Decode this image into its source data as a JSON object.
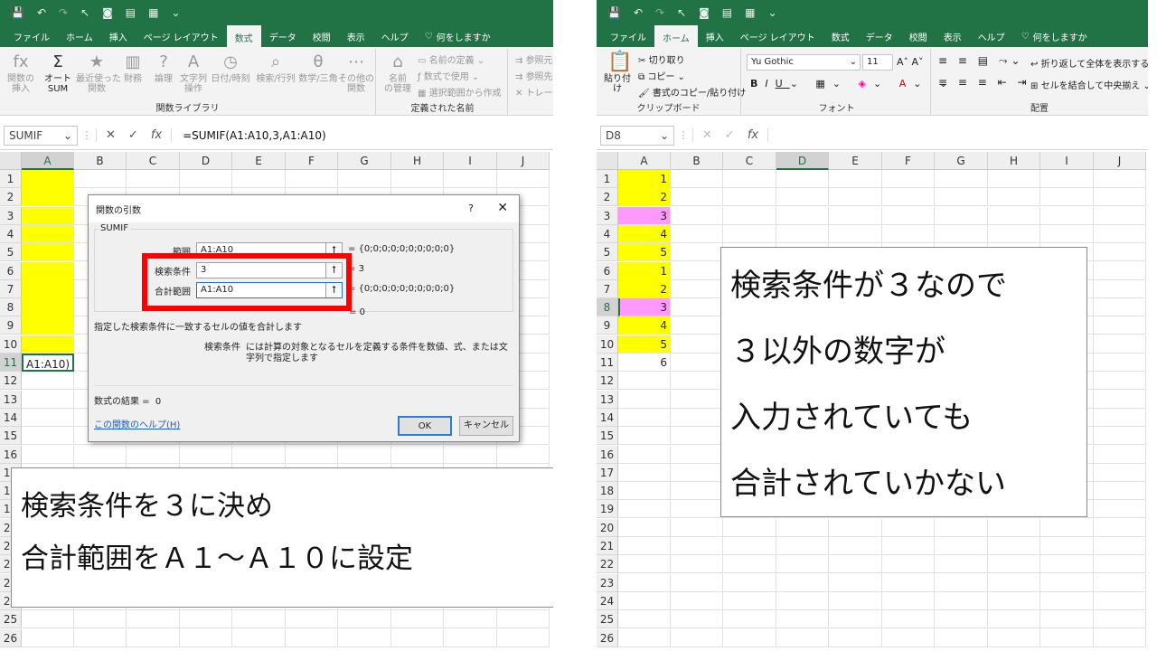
{
  "left": {
    "tabs": [
      "ファイル",
      "ホーム",
      "挿入",
      "ページ レイアウト",
      "数式",
      "データ",
      "校閲",
      "表示",
      "ヘルプ",
      "何をしますか"
    ],
    "active_tab": "数式",
    "ribbon": {
      "buttons": [
        "関数の\n挿入",
        "オート\nSUM",
        "最近使った\n関数",
        "財務",
        "論理",
        "文字列\n操作",
        "日付/時刻",
        "検索/行列",
        "数学/三角",
        "その他の\n関数"
      ],
      "group1": "関数ライブラリ",
      "named": [
        "名前の定義",
        "数式で使用",
        "選択範囲から作成"
      ],
      "name_mgr": "名前\nの管理",
      "group2": "定義された名前",
      "audit": [
        "参照元",
        "参照先",
        "トレース"
      ]
    },
    "namebox": "SUMIF",
    "formula": "=SUMIF(A1:A10,3,A1:A10)",
    "columns": [
      "A",
      "B",
      "C",
      "D",
      "E",
      "F",
      "G",
      "H",
      "I",
      "J"
    ],
    "rows": [
      "1",
      "2",
      "3",
      "4",
      "5",
      "6",
      "7",
      "8",
      "9",
      "10",
      "11",
      "12",
      "13",
      "14",
      "15",
      "16",
      "17",
      "18",
      "19",
      "20",
      "21",
      "22",
      "23",
      "24",
      "25",
      "26"
    ],
    "a11": "A1:A10)",
    "dialog": {
      "title": "関数の引数",
      "help_q": "?",
      "close": "✕",
      "func": "SUMIF",
      "args": [
        {
          "label": "範囲",
          "value": "A1:A10",
          "result": "{0;0;0;0;0;0;0;0;0;0}"
        },
        {
          "label": "検索条件",
          "value": "3",
          "result": "3"
        },
        {
          "label": "合計範囲",
          "value": "A1:A10",
          "result": "{0;0;0;0;0;0;0;0;0;0}"
        }
      ],
      "total": "0",
      "desc": "指定した検索条件に一致するセルの値を合計します",
      "arg_name": "検索条件",
      "arg_desc": "には計算の対象となるセルを定義する条件を数値、式、または文字列で指定します",
      "result_label": "数式の結果 =",
      "result_value": "0",
      "help_link": "この関数のヘルプ(H)",
      "ok": "OK",
      "cancel": "キャンセル"
    },
    "callout": [
      "検索条件を３に決め",
      "合計範囲をＡ１～Ａ１０に設定"
    ]
  },
  "right": {
    "tabs": [
      "ファイル",
      "ホーム",
      "挿入",
      "ページ レイアウト",
      "数式",
      "データ",
      "校閲",
      "表示",
      "ヘルプ",
      "何をしますか"
    ],
    "active_tab": "ホーム",
    "ribbon": {
      "paste": "貼り付け",
      "cut": "切り取り",
      "copy": "コピー",
      "format_painter": "書式のコピー/貼り付け",
      "clipboard": "クリップボード",
      "font_name": "Yu Gothic",
      "font_size": "11",
      "font": "フォント",
      "wrap": "折り返して全体を表示する",
      "merge": "セルを結合して中央揃え",
      "align": "配置"
    },
    "namebox": "D8",
    "formula": "",
    "columns": [
      "A",
      "B",
      "C",
      "D",
      "E",
      "F",
      "G",
      "H",
      "I",
      "J"
    ],
    "rows": [
      "1",
      "2",
      "3",
      "4",
      "5",
      "6",
      "7",
      "8",
      "9",
      "10",
      "11",
      "12",
      "13",
      "14",
      "15",
      "16",
      "17",
      "18",
      "19",
      "20",
      "21",
      "22",
      "23",
      "24",
      "25",
      "26"
    ],
    "values": [
      "1",
      "2",
      "3",
      "4",
      "5",
      "1",
      "2",
      "3",
      "4",
      "5",
      "6"
    ],
    "callout": [
      "検索条件が３なので",
      "３以外の数字が",
      "入力されていても",
      "合計されていかない"
    ]
  },
  "colors": {
    "excel_green": "#217346",
    "yellow": "#ffff00",
    "pink": "#ff99ff",
    "red": "#ff0000"
  }
}
